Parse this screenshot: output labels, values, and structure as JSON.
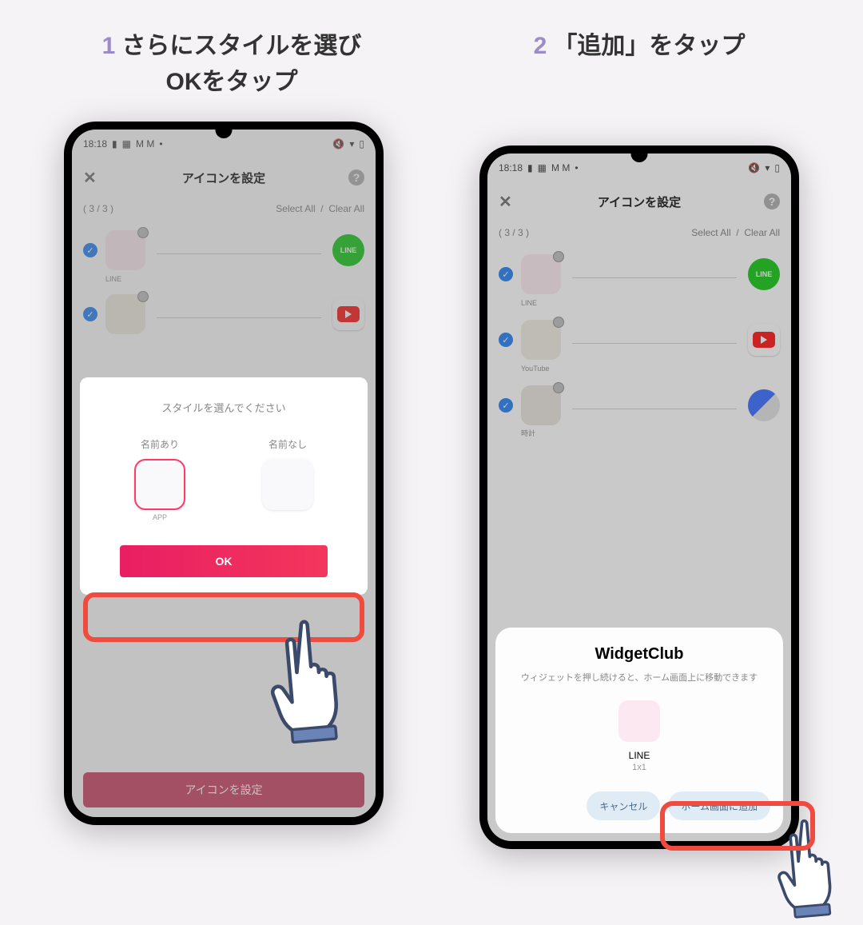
{
  "captions": {
    "step1_num": "1",
    "step1_text": "さらにスタイルを選び\nOKをタップ",
    "step2_num": "2",
    "step2_text": "「追加」をタップ"
  },
  "phone1": {
    "status_time": "18:18",
    "header_title": "アイコンを設定",
    "counter": "( 3 / 3 )",
    "select_all": "Select All",
    "clear_all": "Clear All",
    "rows": [
      {
        "label": "LINE"
      },
      {
        "label": ""
      }
    ],
    "bottom_button": "アイコンを設定",
    "modal": {
      "title": "スタイルを選んでください",
      "opt1_label": "名前あり",
      "opt1_app": "APP",
      "opt2_label": "名前なし",
      "ok": "OK"
    }
  },
  "phone2": {
    "status_time": "18:18",
    "header_title": "アイコンを設定",
    "counter": "( 3 / 3 )",
    "select_all": "Select All",
    "clear_all": "Clear All",
    "rows": [
      {
        "label": "LINE"
      },
      {
        "label": "YouTube"
      },
      {
        "label": "時計"
      }
    ],
    "sheet": {
      "title": "WidgetClub",
      "desc": "ウィジェットを押し続けると、ホーム画面上に移動できます",
      "preview_name": "LINE",
      "preview_size": "1x1",
      "cancel": "キャンセル",
      "add": "ホーム画面に追加"
    }
  }
}
